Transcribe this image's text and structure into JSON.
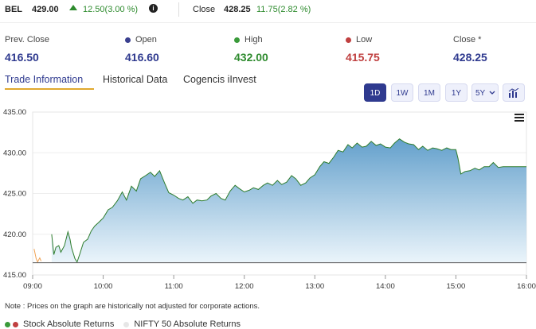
{
  "header": {
    "symbol": "BEL",
    "price": "429.00",
    "change": "12.50(3.00 %)",
    "close_label": "Close",
    "close_value": "428.25",
    "close_change": "11.75(2.82 %)"
  },
  "stats": [
    {
      "label": "Prev. Close",
      "value": "416.50",
      "dot_color": "",
      "value_color": "#2f3a8f"
    },
    {
      "label": "Open",
      "value": "416.60",
      "dot_color": "#3a3f8f",
      "value_color": "#2f3a8f"
    },
    {
      "label": "High",
      "value": "432.00",
      "dot_color": "#3a9a3a",
      "value_color": "#2e8b2e"
    },
    {
      "label": "Low",
      "value": "415.75",
      "dot_color": "#c04040",
      "value_color": "#c04040"
    },
    {
      "label": "Close *",
      "value": "428.25",
      "dot_color": "",
      "value_color": "#2f3a8f"
    }
  ],
  "tabs": [
    {
      "label": "Trade Information",
      "active": true
    },
    {
      "label": "Historical Data",
      "active": false
    },
    {
      "label": "Cogencis iInvest",
      "active": false
    }
  ],
  "range_buttons": [
    {
      "label": "1D",
      "active": true
    },
    {
      "label": "1W",
      "active": false
    },
    {
      "label": "1M",
      "active": false
    },
    {
      "label": "1Y",
      "active": false
    },
    {
      "label": "5Y",
      "active": false
    }
  ],
  "chart_data": {
    "type": "area",
    "x_ticks": [
      "09:00",
      "10:00",
      "11:00",
      "12:00",
      "13:00",
      "14:00",
      "15:00",
      "16:00"
    ],
    "y_ticks": [
      "435.00",
      "430.00",
      "425.00",
      "420.00",
      "415.00"
    ],
    "ylim": [
      415,
      435
    ],
    "xlim": [
      9.0,
      16.0
    ],
    "baseline": 416.5,
    "pre_open": [
      [
        9.02,
        418.2
      ],
      [
        9.05,
        417.0
      ],
      [
        9.07,
        416.6
      ],
      [
        9.1,
        417.1
      ],
      [
        9.12,
        416.7
      ]
    ],
    "series": [
      {
        "name": "Stock Absolute Returns",
        "points": [
          [
            9.27,
            420.0
          ],
          [
            9.3,
            417.5
          ],
          [
            9.33,
            418.4
          ],
          [
            9.37,
            418.6
          ],
          [
            9.4,
            417.8
          ],
          [
            9.45,
            418.6
          ],
          [
            9.5,
            420.3
          ],
          [
            9.53,
            419.4
          ],
          [
            9.55,
            418.4
          ],
          [
            9.6,
            417.0
          ],
          [
            9.63,
            416.6
          ],
          [
            9.67,
            417.6
          ],
          [
            9.72,
            419.0
          ],
          [
            9.78,
            419.4
          ],
          [
            9.83,
            420.4
          ],
          [
            9.88,
            421.0
          ],
          [
            9.93,
            421.4
          ],
          [
            10.0,
            422.0
          ],
          [
            10.07,
            423.0
          ],
          [
            10.13,
            423.3
          ],
          [
            10.2,
            424.1
          ],
          [
            10.27,
            425.2
          ],
          [
            10.33,
            424.2
          ],
          [
            10.4,
            425.9
          ],
          [
            10.47,
            425.3
          ],
          [
            10.53,
            426.8
          ],
          [
            10.6,
            427.2
          ],
          [
            10.67,
            427.6
          ],
          [
            10.73,
            427.1
          ],
          [
            10.8,
            427.8
          ],
          [
            10.87,
            426.3
          ],
          [
            10.93,
            425.1
          ],
          [
            11.0,
            424.8
          ],
          [
            11.07,
            424.4
          ],
          [
            11.13,
            424.2
          ],
          [
            11.2,
            424.6
          ],
          [
            11.27,
            423.8
          ],
          [
            11.33,
            424.2
          ],
          [
            11.4,
            424.1
          ],
          [
            11.47,
            424.2
          ],
          [
            11.53,
            424.7
          ],
          [
            11.6,
            425.0
          ],
          [
            11.67,
            424.4
          ],
          [
            11.73,
            424.2
          ],
          [
            11.8,
            425.3
          ],
          [
            11.87,
            426.0
          ],
          [
            11.93,
            425.6
          ],
          [
            12.0,
            425.2
          ],
          [
            12.07,
            425.4
          ],
          [
            12.13,
            425.7
          ],
          [
            12.2,
            425.5
          ],
          [
            12.27,
            426.0
          ],
          [
            12.33,
            426.3
          ],
          [
            12.4,
            426.0
          ],
          [
            12.47,
            426.6
          ],
          [
            12.53,
            426.1
          ],
          [
            12.6,
            426.4
          ],
          [
            12.67,
            427.2
          ],
          [
            12.73,
            426.8
          ],
          [
            12.8,
            426.0
          ],
          [
            12.87,
            426.3
          ],
          [
            12.93,
            426.9
          ],
          [
            13.0,
            427.3
          ],
          [
            13.07,
            428.3
          ],
          [
            13.13,
            428.9
          ],
          [
            13.2,
            428.7
          ],
          [
            13.27,
            429.5
          ],
          [
            13.33,
            430.3
          ],
          [
            13.4,
            430.1
          ],
          [
            13.47,
            431.0
          ],
          [
            13.53,
            430.6
          ],
          [
            13.6,
            431.2
          ],
          [
            13.67,
            430.7
          ],
          [
            13.73,
            430.8
          ],
          [
            13.8,
            431.4
          ],
          [
            13.87,
            430.9
          ],
          [
            13.93,
            431.1
          ],
          [
            14.0,
            430.7
          ],
          [
            14.07,
            430.6
          ],
          [
            14.13,
            431.2
          ],
          [
            14.2,
            431.7
          ],
          [
            14.27,
            431.3
          ],
          [
            14.33,
            431.1
          ],
          [
            14.4,
            431.0
          ],
          [
            14.47,
            430.4
          ],
          [
            14.53,
            430.8
          ],
          [
            14.6,
            430.3
          ],
          [
            14.67,
            430.6
          ],
          [
            14.73,
            430.5
          ],
          [
            14.8,
            430.3
          ],
          [
            14.87,
            430.6
          ],
          [
            14.93,
            430.4
          ],
          [
            15.0,
            430.4
          ],
          [
            15.03,
            429.3
          ],
          [
            15.07,
            427.4
          ],
          [
            15.13,
            427.7
          ],
          [
            15.2,
            427.8
          ],
          [
            15.27,
            428.1
          ],
          [
            15.33,
            427.9
          ],
          [
            15.4,
            428.3
          ],
          [
            15.47,
            428.3
          ],
          [
            15.53,
            428.8
          ],
          [
            15.6,
            428.2
          ],
          [
            15.67,
            428.3
          ],
          [
            15.73,
            428.3
          ],
          [
            15.8,
            428.3
          ],
          [
            15.87,
            428.3
          ],
          [
            15.93,
            428.3
          ],
          [
            16.0,
            428.3
          ]
        ]
      }
    ]
  },
  "note": "Note : Prices on the graph are historically not adjusted for corporate actions.",
  "legend": [
    {
      "label": "Stock Absolute Returns",
      "colors": [
        "#3a9a3a",
        "#c04040"
      ]
    },
    {
      "label": "NIFTY 50 Absolute Returns",
      "colors": [
        "#e6e6e6"
      ]
    }
  ]
}
